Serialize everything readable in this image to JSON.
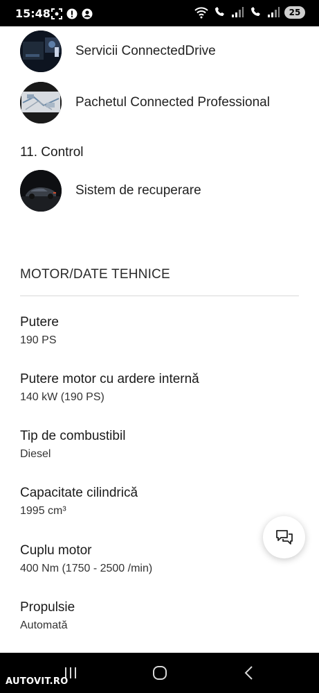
{
  "status_bar": {
    "time": "15:48",
    "left_icons": [
      "screenshot-icon",
      "alert-icon",
      "account-icon"
    ],
    "right_icons": [
      "wifi-icon",
      "volte-call-icon",
      "signal-icon",
      "volte-call-icon",
      "signal-icon"
    ],
    "battery": "25"
  },
  "services": [
    {
      "label": "Servicii ConnectedDrive"
    },
    {
      "label": "Pachetul Connected Professional"
    }
  ],
  "control_section": {
    "heading": "11. Control",
    "items": [
      {
        "label": "Sistem de recuperare"
      }
    ]
  },
  "motor": {
    "title": "MOTOR/DATE TEHNICE",
    "specs": [
      {
        "label": "Putere",
        "value": "190 PS"
      },
      {
        "label": "Putere motor cu ardere internă",
        "value": "140 kW (190 PS)"
      },
      {
        "label": "Tip de combustibil",
        "value": "Diesel"
      },
      {
        "label": "Capacitate cilindrică",
        "value": "1995 cm³"
      },
      {
        "label": "Cuplu motor",
        "value": "400 Nm (1750 - 2500 /min)"
      },
      {
        "label": "Propulsie",
        "value": "Automată"
      }
    ]
  },
  "chat_button": {
    "icon": "chat-icon"
  },
  "nav_bar": {
    "icons": [
      "recent-apps-icon",
      "home-icon",
      "back-icon"
    ]
  },
  "watermark": "AUTOVIT.RO"
}
